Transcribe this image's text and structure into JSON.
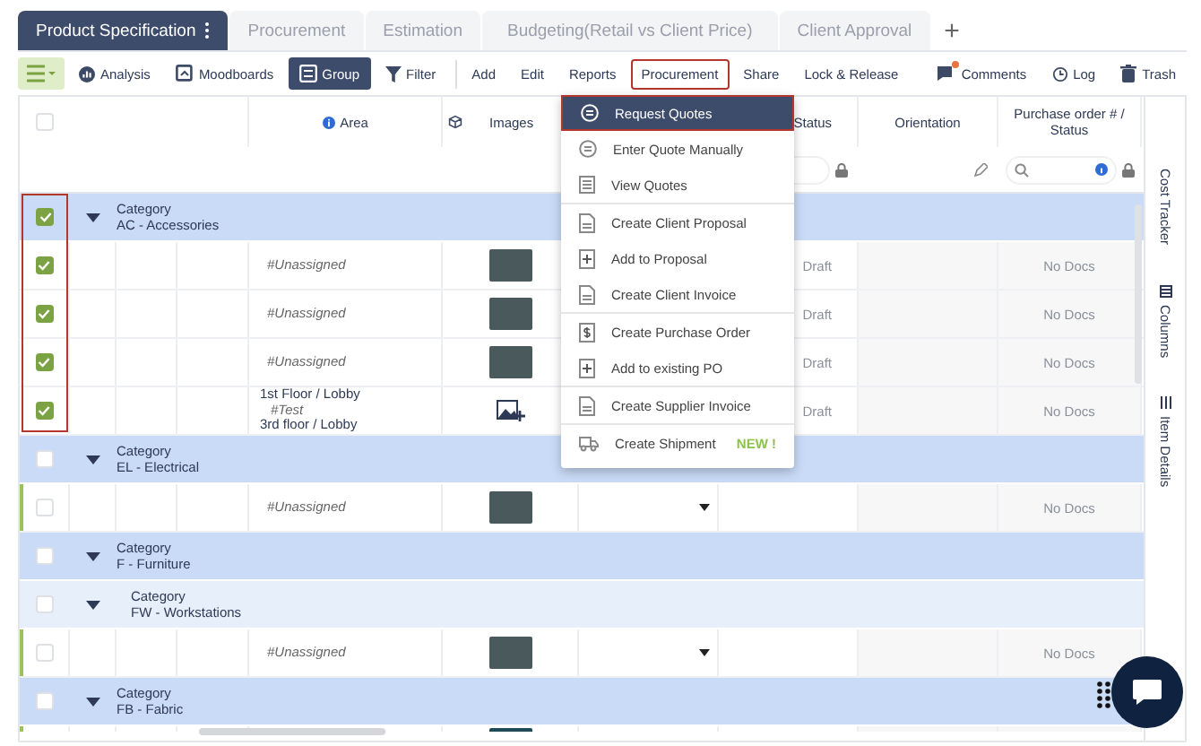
{
  "tabs": [
    {
      "label": "Product Specification",
      "selected": true,
      "menu": true
    },
    {
      "label": "Procurement",
      "selected": false,
      "menu": false
    },
    {
      "label": "Estimation",
      "selected": false,
      "menu": false
    },
    {
      "label": "Budgeting(Retail vs Client Price)",
      "selected": false,
      "menu": false
    },
    {
      "label": "Client Approval",
      "selected": false,
      "menu": false
    }
  ],
  "add_tab": "+",
  "toolbar": {
    "left": [
      {
        "kind": "menu",
        "selected": false,
        "highlighted": false,
        "separated": false
      },
      {
        "kind": "analysis",
        "label": "Analysis",
        "selected": false,
        "highlighted": false,
        "separated": false
      },
      {
        "kind": "moodboards",
        "label": "Moodboards",
        "selected": false,
        "highlighted": false,
        "separated": false
      },
      {
        "kind": "group",
        "label": "Group",
        "selected": true,
        "highlighted": false,
        "separated": false
      },
      {
        "kind": "filter",
        "label": "Filter",
        "selected": false,
        "highlighted": false,
        "separated": false
      },
      {
        "kind": "text",
        "label": "Add",
        "selected": false,
        "highlighted": false,
        "separated": true
      },
      {
        "kind": "text",
        "label": "Edit",
        "selected": false,
        "highlighted": false,
        "separated": false
      },
      {
        "kind": "text",
        "label": "Reports",
        "selected": false,
        "highlighted": false,
        "separated": false
      },
      {
        "kind": "text",
        "label": "Procurement",
        "selected": false,
        "highlighted": true,
        "separated": false
      },
      {
        "kind": "text",
        "label": "Share",
        "selected": false,
        "highlighted": false,
        "separated": false
      },
      {
        "kind": "text",
        "label": "Lock & Release",
        "selected": false,
        "highlighted": false,
        "separated": false
      }
    ],
    "right": [
      {
        "kind": "comments",
        "label": "Comments",
        "notification": true
      },
      {
        "kind": "log",
        "label": "Log"
      },
      {
        "kind": "trash",
        "label": "Trash"
      }
    ]
  },
  "procurement_menu": {
    "items": [
      {
        "kind": "quote",
        "label": "Request Quotes",
        "selected": true,
        "highlighted": true,
        "divider_after": false
      },
      {
        "kind": "quote",
        "label": "Enter Quote Manually",
        "selected": false,
        "highlighted": false,
        "divider_after": false
      },
      {
        "kind": "list",
        "label": "View Quotes",
        "selected": false,
        "highlighted": false,
        "divider_after": true
      },
      {
        "kind": "doc",
        "label": "Create Client Proposal",
        "selected": false,
        "highlighted": false,
        "divider_after": false
      },
      {
        "kind": "add",
        "label": "Add to Proposal",
        "selected": false,
        "highlighted": false,
        "divider_after": false
      },
      {
        "kind": "doc",
        "label": "Create Client Invoice",
        "selected": false,
        "highlighted": false,
        "divider_after": true
      },
      {
        "kind": "dollar",
        "label": "Create Purchase Order",
        "selected": false,
        "highlighted": false,
        "divider_after": false
      },
      {
        "kind": "add",
        "label": "Add to existing PO",
        "selected": false,
        "highlighted": false,
        "divider_after": true
      },
      {
        "kind": "doc",
        "label": "Create Supplier Invoice",
        "selected": false,
        "highlighted": false,
        "divider_after": true
      },
      {
        "kind": "truck",
        "label": "Create Shipment",
        "badge": "NEW !",
        "selected": false,
        "highlighted": false,
        "divider_after": false
      }
    ]
  },
  "table": {
    "header": {
      "select_all": {
        "checked": false
      },
      "area": "Area",
      "images": "Images",
      "status": "Status",
      "orientation": "Orientation",
      "purchase_order": "Purchase order # / Status"
    },
    "rows": [
      {
        "kind": "group",
        "title": "Category",
        "name": "AC - Accessories",
        "checked": true,
        "expanded": true,
        "highlighted": true,
        "children": [
          {
            "kind": "item",
            "checked": true,
            "area": [
              {
                "kind": "tag",
                "text": "#Unassigned"
              }
            ],
            "image": {
              "kind": "photo"
            },
            "status": "Draft",
            "purchase_order": "No Docs"
          },
          {
            "kind": "item",
            "checked": true,
            "area": [
              {
                "kind": "tag",
                "text": "#Unassigned"
              }
            ],
            "image": {
              "kind": "photo"
            },
            "status": "Draft",
            "purchase_order": "No Docs"
          },
          {
            "kind": "item",
            "checked": true,
            "area": [
              {
                "kind": "tag",
                "text": "#Unassigned"
              }
            ],
            "image": {
              "kind": "photo"
            },
            "status": "Draft",
            "purchase_order": "No Docs"
          },
          {
            "kind": "item",
            "checked": true,
            "area": [
              {
                "kind": "location",
                "text": "1st Floor / Lobby"
              },
              {
                "kind": "tag",
                "text": "#Test"
              },
              {
                "kind": "location",
                "text": "3rd floor / Lobby"
              }
            ],
            "image": {
              "kind": "add"
            },
            "status": "Draft",
            "purchase_order": "No Docs"
          }
        ]
      },
      {
        "kind": "group",
        "title": "Category",
        "name": "EL - Electrical",
        "checked": false,
        "expanded": true,
        "children": [
          {
            "kind": "item",
            "checked": false,
            "area": [
              {
                "kind": "tag",
                "text": "#Unassigned"
              }
            ],
            "image": {
              "kind": "photo"
            },
            "purchase_order": "No Docs"
          }
        ]
      },
      {
        "kind": "group",
        "title": "Category",
        "name": "F - Furniture",
        "checked": false,
        "expanded": true,
        "children": [
          {
            "kind": "group",
            "title": "Category",
            "name": "FW - Workstations",
            "checked": false,
            "expanded": true,
            "children": [
              {
                "kind": "item",
                "checked": false,
                "area": [
                  {
                    "kind": "tag",
                    "text": "#Unassigned"
                  }
                ],
                "image": {
                  "kind": "photo"
                },
                "purchase_order": "No Docs"
              }
            ]
          }
        ]
      },
      {
        "kind": "group",
        "title": "Category",
        "name": "FB - Fabric",
        "checked": false,
        "expanded": true,
        "children": [
          {
            "kind": "partial",
            "image": {
              "kind": "photo"
            }
          }
        ]
      }
    ]
  },
  "side_panel": [
    {
      "kind": "plain",
      "label": "Cost Tracker"
    },
    {
      "kind": "columns",
      "label": "Columns"
    },
    {
      "kind": "details",
      "label": "Item Details"
    }
  ]
}
